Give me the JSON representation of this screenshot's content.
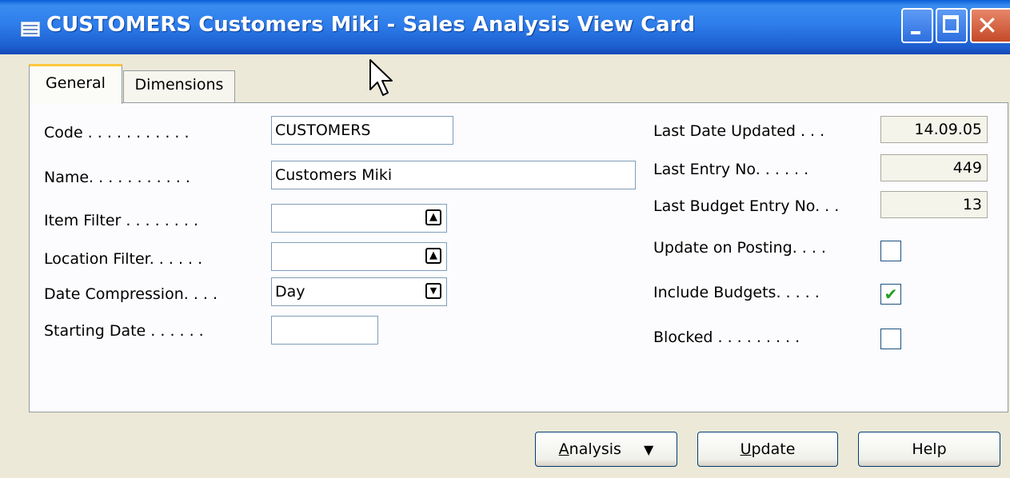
{
  "window": {
    "title": "CUSTOMERS Customers Miki - Sales Analysis View Card",
    "icons": {
      "app": "table-icon",
      "minimize": "minimize-icon",
      "maximize": "maximize-icon",
      "close": "close-icon"
    }
  },
  "tabs": [
    {
      "label": "General",
      "active": true
    },
    {
      "label": "Dimensions",
      "active": false
    }
  ],
  "left_fields": {
    "code": {
      "label": "Code . . . . . . . . . . .",
      "value": "CUSTOMERS"
    },
    "name": {
      "label": "Name. . . . . . . . . . .",
      "value": "Customers Miki"
    },
    "item_filter": {
      "label": "Item Filter . . . . . . . .",
      "value": ""
    },
    "location_filter": {
      "label": "Location Filter. . . . . .",
      "value": ""
    },
    "date_compression": {
      "label": "Date Compression. . . .",
      "value": "Day"
    },
    "starting_date": {
      "label": "Starting Date . . . . . .",
      "value": ""
    }
  },
  "right_fields": {
    "last_date_updated": {
      "label": "Last Date Updated . . .",
      "value": "14.09.05"
    },
    "last_entry_no": {
      "label": "Last Entry No. . . . . .",
      "value": "449"
    },
    "last_budget_entry_no": {
      "label": "Last Budget Entry No. . .",
      "value": "13"
    },
    "update_on_posting": {
      "label": "Update on Posting. . . .",
      "checked": false
    },
    "include_budgets": {
      "label": "Include Budgets. . . . .",
      "checked": true
    },
    "blocked": {
      "label": "Blocked . . . . . . . . .",
      "checked": false
    }
  },
  "buttons": {
    "analysis": {
      "label_first": "A",
      "label_rest": "nalysis",
      "dropdown": "▼"
    },
    "update": {
      "label_first": "U",
      "label_rest": "pdate"
    },
    "help": {
      "label": "Help"
    }
  },
  "glyphs": {
    "lookup": "🠅",
    "dropdown": "▼",
    "check": "✔"
  }
}
